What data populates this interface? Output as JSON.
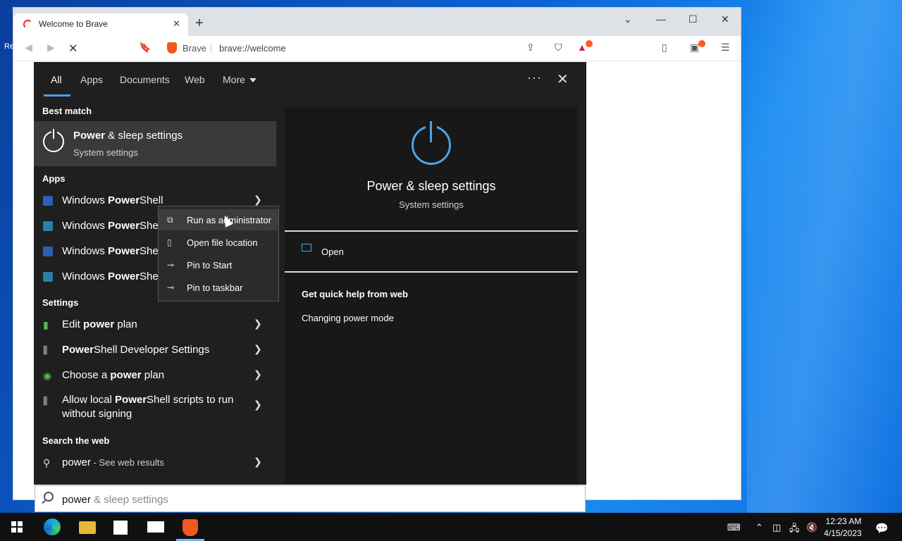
{
  "browser": {
    "tab_title": "Welcome to Brave",
    "new_tab": "+",
    "tab_close": "✕",
    "controls": {
      "dropdown": "⌄",
      "minimize": "—",
      "maximize": "☐",
      "close": "✕"
    },
    "omnibox": {
      "site": "Brave",
      "url": "brave://welcome"
    },
    "notification_count": "1"
  },
  "desktop": {
    "label": "Re"
  },
  "search": {
    "filters": [
      "All",
      "Apps",
      "Documents",
      "Web",
      "More"
    ],
    "active_filter": "All",
    "best_match_header": "Best match",
    "best_match": {
      "title_bold": "Power",
      "title_rest": " & sleep settings",
      "subtitle": "System settings"
    },
    "apps_header": "Apps",
    "apps": [
      {
        "pre": "Windows ",
        "bold": "Power",
        "post": "Shell"
      },
      {
        "pre": "Windows ",
        "bold": "Power",
        "post": "Shell"
      },
      {
        "pre": "Windows ",
        "bold": "Power",
        "post": "Shell"
      },
      {
        "pre": "Windows ",
        "bold": "Power",
        "post": "Shell"
      }
    ],
    "settings_header": "Settings",
    "settings": [
      {
        "pre": "Edit ",
        "bold": "power",
        "post": " plan"
      },
      {
        "pre": "",
        "bold": "Power",
        "post": "Shell Developer Settings"
      },
      {
        "pre": "Choose a ",
        "bold": "power",
        "post": " plan"
      },
      {
        "pre": "Allow local ",
        "bold": "Power",
        "post": "Shell scripts to run",
        "line2": "without signing"
      }
    ],
    "web_header": "Search the web",
    "web": {
      "term": "power",
      "suffix": " - See web results"
    },
    "preview": {
      "title": "Power & sleep settings",
      "subtitle": "System settings",
      "open": "Open",
      "quick_help": "Get quick help from web",
      "link": "Changing power mode"
    },
    "query_typed": "power",
    "query_suggest": " & sleep settings"
  },
  "context_menu": [
    {
      "label": "Run as administrator",
      "icon": "shield-window-icon"
    },
    {
      "label": "Open file location",
      "icon": "folder-location-icon"
    },
    {
      "label": "Pin to Start",
      "icon": "pin-icon"
    },
    {
      "label": "Pin to taskbar",
      "icon": "pin-icon"
    }
  ],
  "taskbar": {
    "time": "12:23 AM",
    "date": "4/15/2023"
  },
  "colors": {
    "accent": "#4aa6e8",
    "brave": "#f2581e",
    "panel_bg": "#1f1f1f"
  }
}
